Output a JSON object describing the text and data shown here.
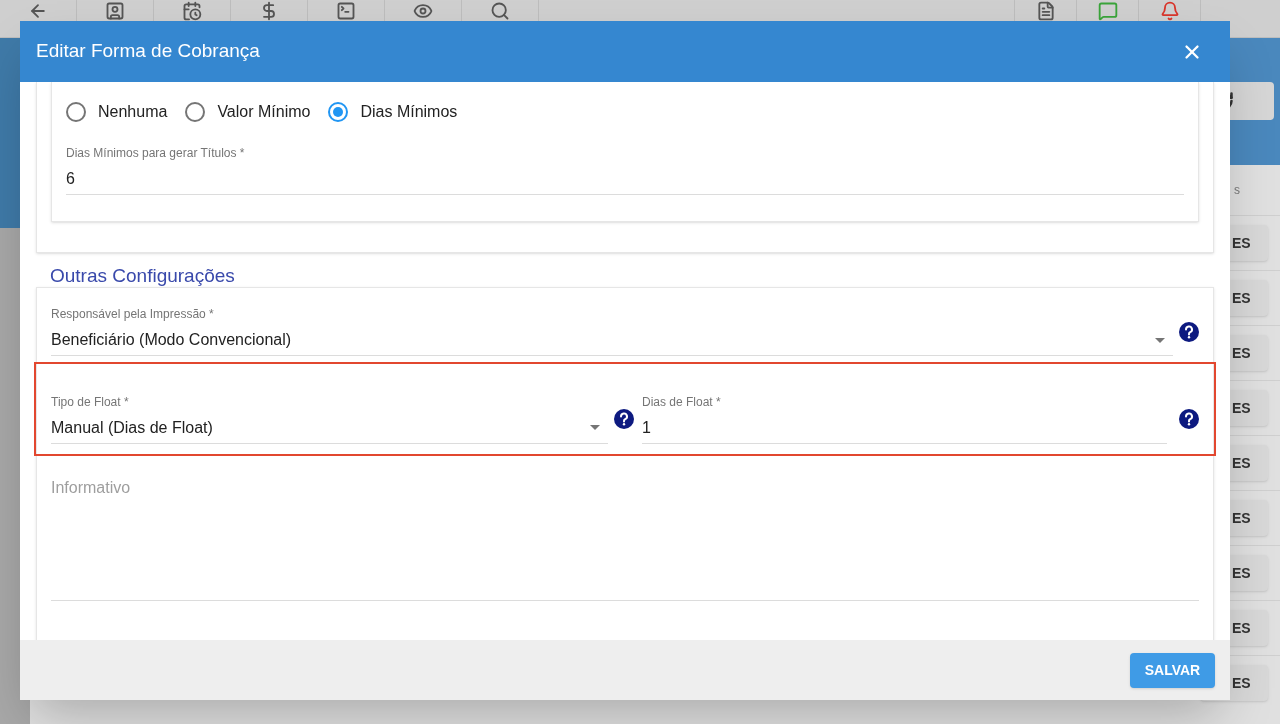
{
  "background": {
    "column_header": "s",
    "row_buttons": [
      "ES",
      "ES",
      "ES",
      "ES",
      "ES",
      "ES",
      "ES",
      "ES",
      "ES"
    ]
  },
  "dialog": {
    "title": "Editar Forma de Cobrança",
    "radio_options": [
      {
        "label": "Nenhuma",
        "selected": false
      },
      {
        "label": "Valor Mínimo",
        "selected": false
      },
      {
        "label": "Dias Mínimos",
        "selected": true
      }
    ],
    "min_days_field": {
      "label": "Dias Mínimos para gerar Títulos *",
      "value": "6"
    },
    "section_title": "Outras Configurações",
    "print_responsible": {
      "label": "Responsável pela Impressão *",
      "value": "Beneficiário (Modo Convencional)"
    },
    "float_type": {
      "label": "Tipo de Float *",
      "value": "Manual (Dias de Float)"
    },
    "float_days": {
      "label": "Dias de Float *",
      "value": "1"
    },
    "info": {
      "placeholder": "Informativo"
    },
    "save_button": "SALVAR"
  }
}
